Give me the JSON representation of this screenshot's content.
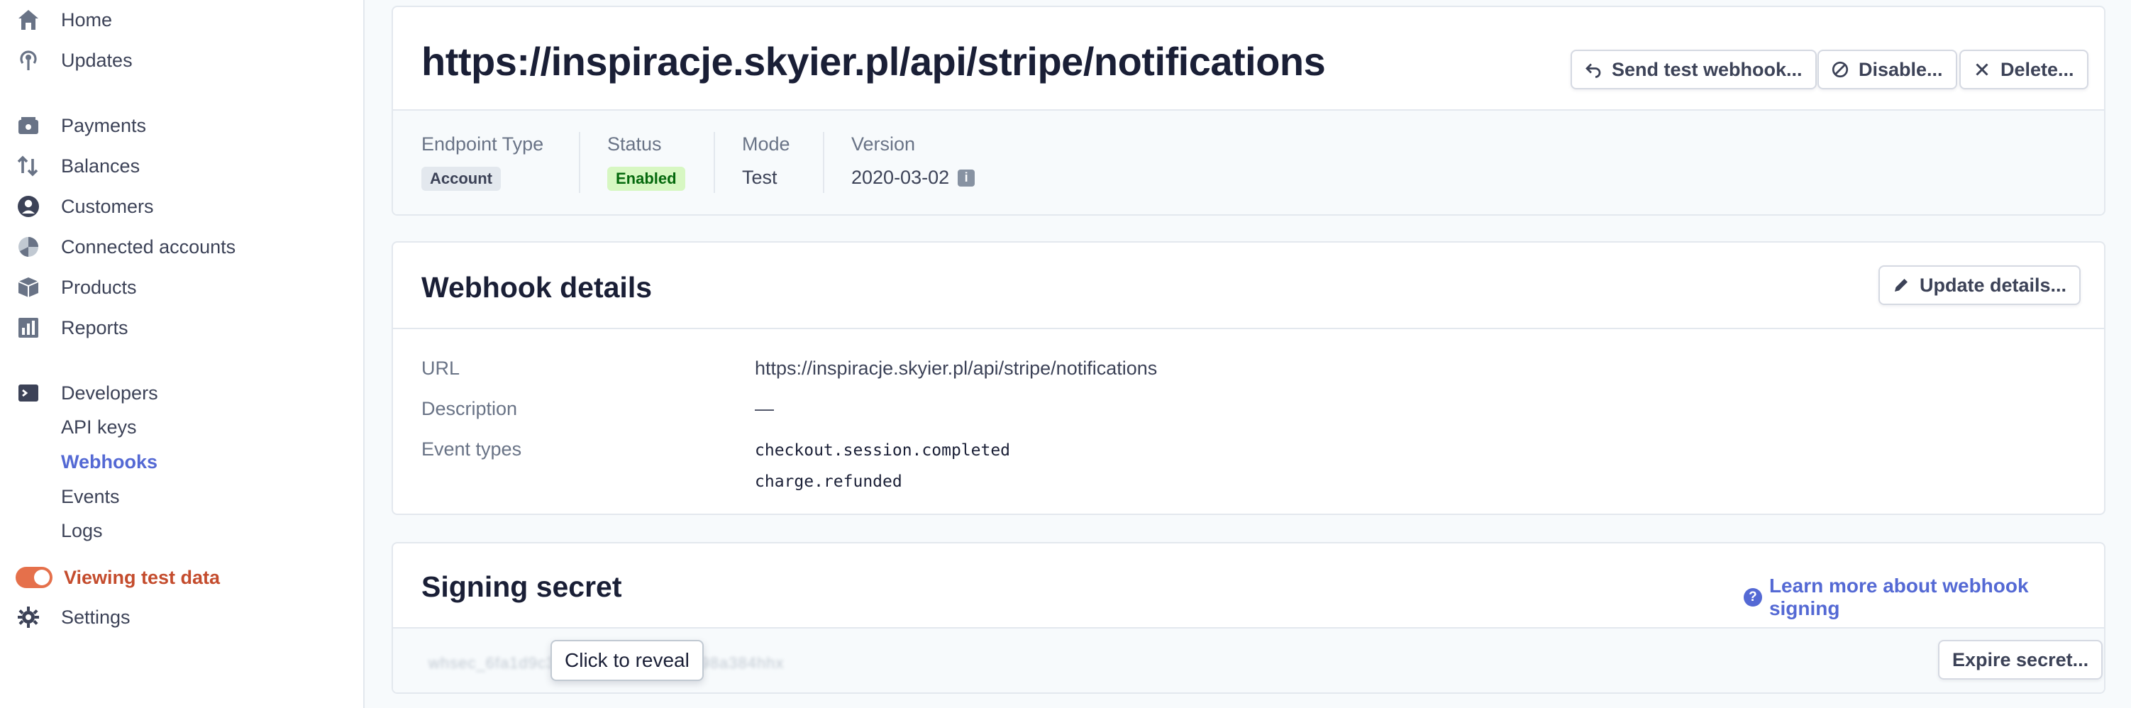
{
  "sidebar": {
    "nav": [
      {
        "label": "Home",
        "icon": "home-icon"
      },
      {
        "label": "Updates",
        "icon": "broadcast-icon"
      },
      {
        "label": "Payments",
        "icon": "payments-icon"
      },
      {
        "label": "Balances",
        "icon": "balances-icon"
      },
      {
        "label": "Customers",
        "icon": "customer-icon"
      },
      {
        "label": "Connected accounts",
        "icon": "connected-accounts-icon"
      },
      {
        "label": "Products",
        "icon": "product-box-icon"
      },
      {
        "label": "Reports",
        "icon": "reports-icon"
      },
      {
        "label": "Developers",
        "icon": "terminal-icon"
      }
    ],
    "developer_sub": [
      "API keys",
      "Webhooks",
      "Events",
      "Logs"
    ],
    "active_sub": "Webhooks",
    "test_data_label": "Viewing test data",
    "settings_label": "Settings"
  },
  "endpoint": {
    "url_title": "https://inspiracje.skyier.pl/api/stripe/notifications",
    "buttons": {
      "send_test": "Send test webhook...",
      "disable": "Disable...",
      "delete": "Delete..."
    },
    "meta": {
      "type_label": "Endpoint Type",
      "type_value": "Account",
      "status_label": "Status",
      "status_value": "Enabled",
      "mode_label": "Mode",
      "mode_value": "Test",
      "version_label": "Version",
      "version_value": "2020-03-02"
    }
  },
  "webhook_details": {
    "title": "Webhook details",
    "update_button": "Update details...",
    "url_label": "URL",
    "url_value": "https://inspiracje.skyier.pl/api/stripe/notifications",
    "description_label": "Description",
    "description_value": "—",
    "event_types_label": "Event types",
    "event_types": [
      "checkout.session.completed",
      "charge.refunded"
    ]
  },
  "signing_secret": {
    "title": "Signing secret",
    "learn_more": "Learn more about webhook signing",
    "masked_value": "whsec_6fa1d9c3b87e2f440a1d5c2398a384hhx",
    "reveal_button": "Click to reveal",
    "expire_button": "Expire secret..."
  },
  "colors": {
    "accent": "#5469d4",
    "test_mode": "#e5704b",
    "enabled_bg": "#d7f7c2",
    "enabled_text": "#05690d"
  }
}
